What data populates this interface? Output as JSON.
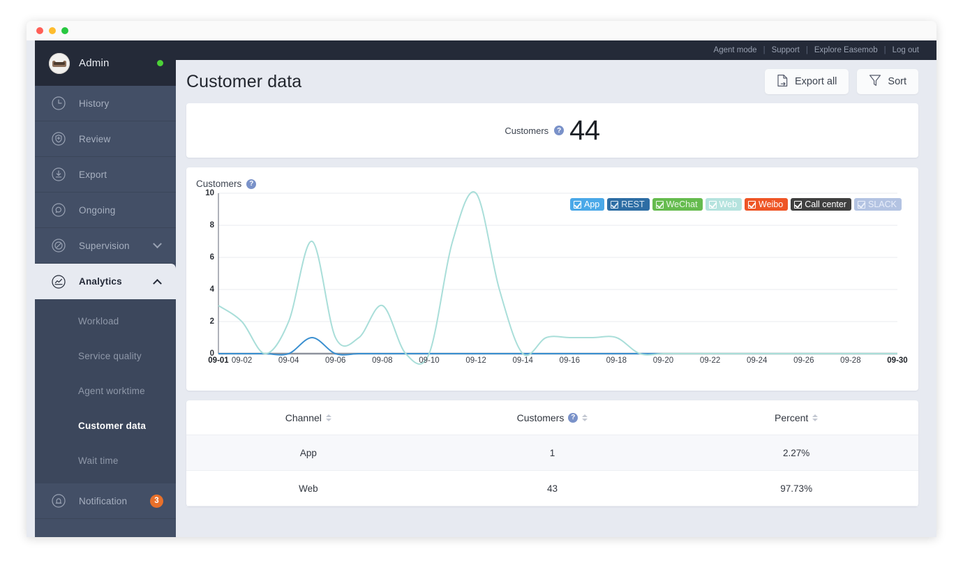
{
  "window": {
    "dots": [
      "close",
      "minimize",
      "zoom"
    ]
  },
  "topbar": {
    "links": [
      "Agent mode",
      "Support",
      "Explore Easemob",
      "Log out"
    ],
    "separator": "|"
  },
  "sidebar": {
    "user": {
      "name": "Admin",
      "status": "online"
    },
    "items": [
      {
        "label": "History",
        "icon": "clock-icon",
        "expandable": false
      },
      {
        "label": "Review",
        "icon": "shield-plus-icon",
        "expandable": false
      },
      {
        "label": "Export",
        "icon": "download-icon",
        "expandable": false
      },
      {
        "label": "Ongoing",
        "icon": "chat-icon",
        "expandable": false
      },
      {
        "label": "Supervision",
        "icon": "compass-icon",
        "expandable": true,
        "expanded": false
      },
      {
        "label": "Analytics",
        "icon": "analytics-icon",
        "expandable": true,
        "expanded": true,
        "active": true
      }
    ],
    "analytics_sub": [
      {
        "label": "Workload",
        "selected": false
      },
      {
        "label": "Service quality",
        "selected": false
      },
      {
        "label": "Agent worktime",
        "selected": false
      },
      {
        "label": "Customer data",
        "selected": true
      },
      {
        "label": "Wait time",
        "selected": false
      }
    ],
    "notification": {
      "label": "Notification",
      "icon": "bell-icon",
      "badge": "3"
    }
  },
  "header": {
    "title": "Customer data",
    "export_label": "Export all",
    "export_icon": "file-export-icon",
    "sort_label": "Sort",
    "sort_icon": "funnel-icon"
  },
  "stat": {
    "label": "Customers",
    "help_icon": "question-icon",
    "help_glyph": "?",
    "value": "44"
  },
  "chart_card": {
    "caption": "Customers",
    "help_glyph": "?"
  },
  "chart_data": {
    "type": "line",
    "title": "Customers",
    "xlabel": "",
    "ylabel": "",
    "ylim": [
      0,
      10
    ],
    "yticks": [
      0,
      2,
      4,
      6,
      8,
      10
    ],
    "grid": true,
    "legend_position": "top-right",
    "x": [
      "09-01",
      "09-02",
      "09-03",
      "09-04",
      "09-05",
      "09-06",
      "09-07",
      "09-08",
      "09-09",
      "09-10",
      "09-11",
      "09-12",
      "09-13",
      "09-14",
      "09-15",
      "09-16",
      "09-17",
      "09-18",
      "09-19",
      "09-20",
      "09-21",
      "09-22",
      "09-23",
      "09-24",
      "09-25",
      "09-26",
      "09-27",
      "09-28",
      "09-29",
      "09-30"
    ],
    "xticks": [
      "09-01",
      "09-02",
      "09-04",
      "09-06",
      "09-08",
      "09-10",
      "09-12",
      "09-14",
      "09-16",
      "09-18",
      "09-20",
      "09-22",
      "09-24",
      "09-26",
      "09-28",
      "09-30"
    ],
    "xticks_bold": [
      "09-01",
      "09-30"
    ],
    "series": [
      {
        "name": "App",
        "color": "#3a8fd0",
        "values": [
          0,
          0,
          0,
          0,
          1,
          0,
          0,
          0,
          0,
          0,
          0,
          0,
          0,
          0,
          0,
          0,
          0,
          0,
          0,
          0,
          0,
          0,
          0,
          0,
          0,
          0,
          0,
          0,
          0,
          0
        ]
      },
      {
        "name": "REST",
        "color": "#2d6da4",
        "values": []
      },
      {
        "name": "WeChat",
        "color": "#65bb4e",
        "values": []
      },
      {
        "name": "Web",
        "color": "#a9ded9",
        "values": [
          3,
          2,
          0,
          2,
          7,
          1,
          1,
          3,
          0,
          0,
          7,
          10,
          4,
          0,
          1,
          1,
          1,
          1,
          0,
          0,
          0,
          0,
          0,
          0,
          0,
          0,
          0,
          0,
          0,
          0
        ]
      },
      {
        "name": "Weibo",
        "color": "#ee5526",
        "values": []
      },
      {
        "name": "Call center",
        "color": "#3f3f3f",
        "values": []
      },
      {
        "name": "SLACK",
        "color": "#b3c3e2",
        "values": []
      }
    ],
    "legend": [
      {
        "label": "App",
        "bg": "#4aa8e8",
        "fg": "#ffffff",
        "checked": true
      },
      {
        "label": "REST",
        "bg": "#2d6da4",
        "fg": "#d8e6f2",
        "checked": true
      },
      {
        "label": "WeChat",
        "bg": "#65bb4e",
        "fg": "#eaf7e6",
        "checked": true
      },
      {
        "label": "Web",
        "bg": "#b5e3de",
        "fg": "#ffffff",
        "checked": true
      },
      {
        "label": "Weibo",
        "bg": "#ee5526",
        "fg": "#ffffff",
        "checked": true
      },
      {
        "label": "Call center",
        "bg": "#3f3f3f",
        "fg": "#ffffff",
        "checked": true
      },
      {
        "label": "SLACK",
        "bg": "#b3c3e2",
        "fg": "#e3eaf6",
        "checked": true
      }
    ]
  },
  "table": {
    "columns": [
      {
        "label": "Channel",
        "sortable": true,
        "help": false
      },
      {
        "label": "Customers",
        "sortable": true,
        "help": true,
        "help_glyph": "?"
      },
      {
        "label": "Percent",
        "sortable": true,
        "help": false
      }
    ],
    "rows": [
      {
        "channel": "App",
        "customers": "1",
        "percent": "2.27%"
      },
      {
        "channel": "Web",
        "customers": "43",
        "percent": "97.73%"
      }
    ]
  }
}
